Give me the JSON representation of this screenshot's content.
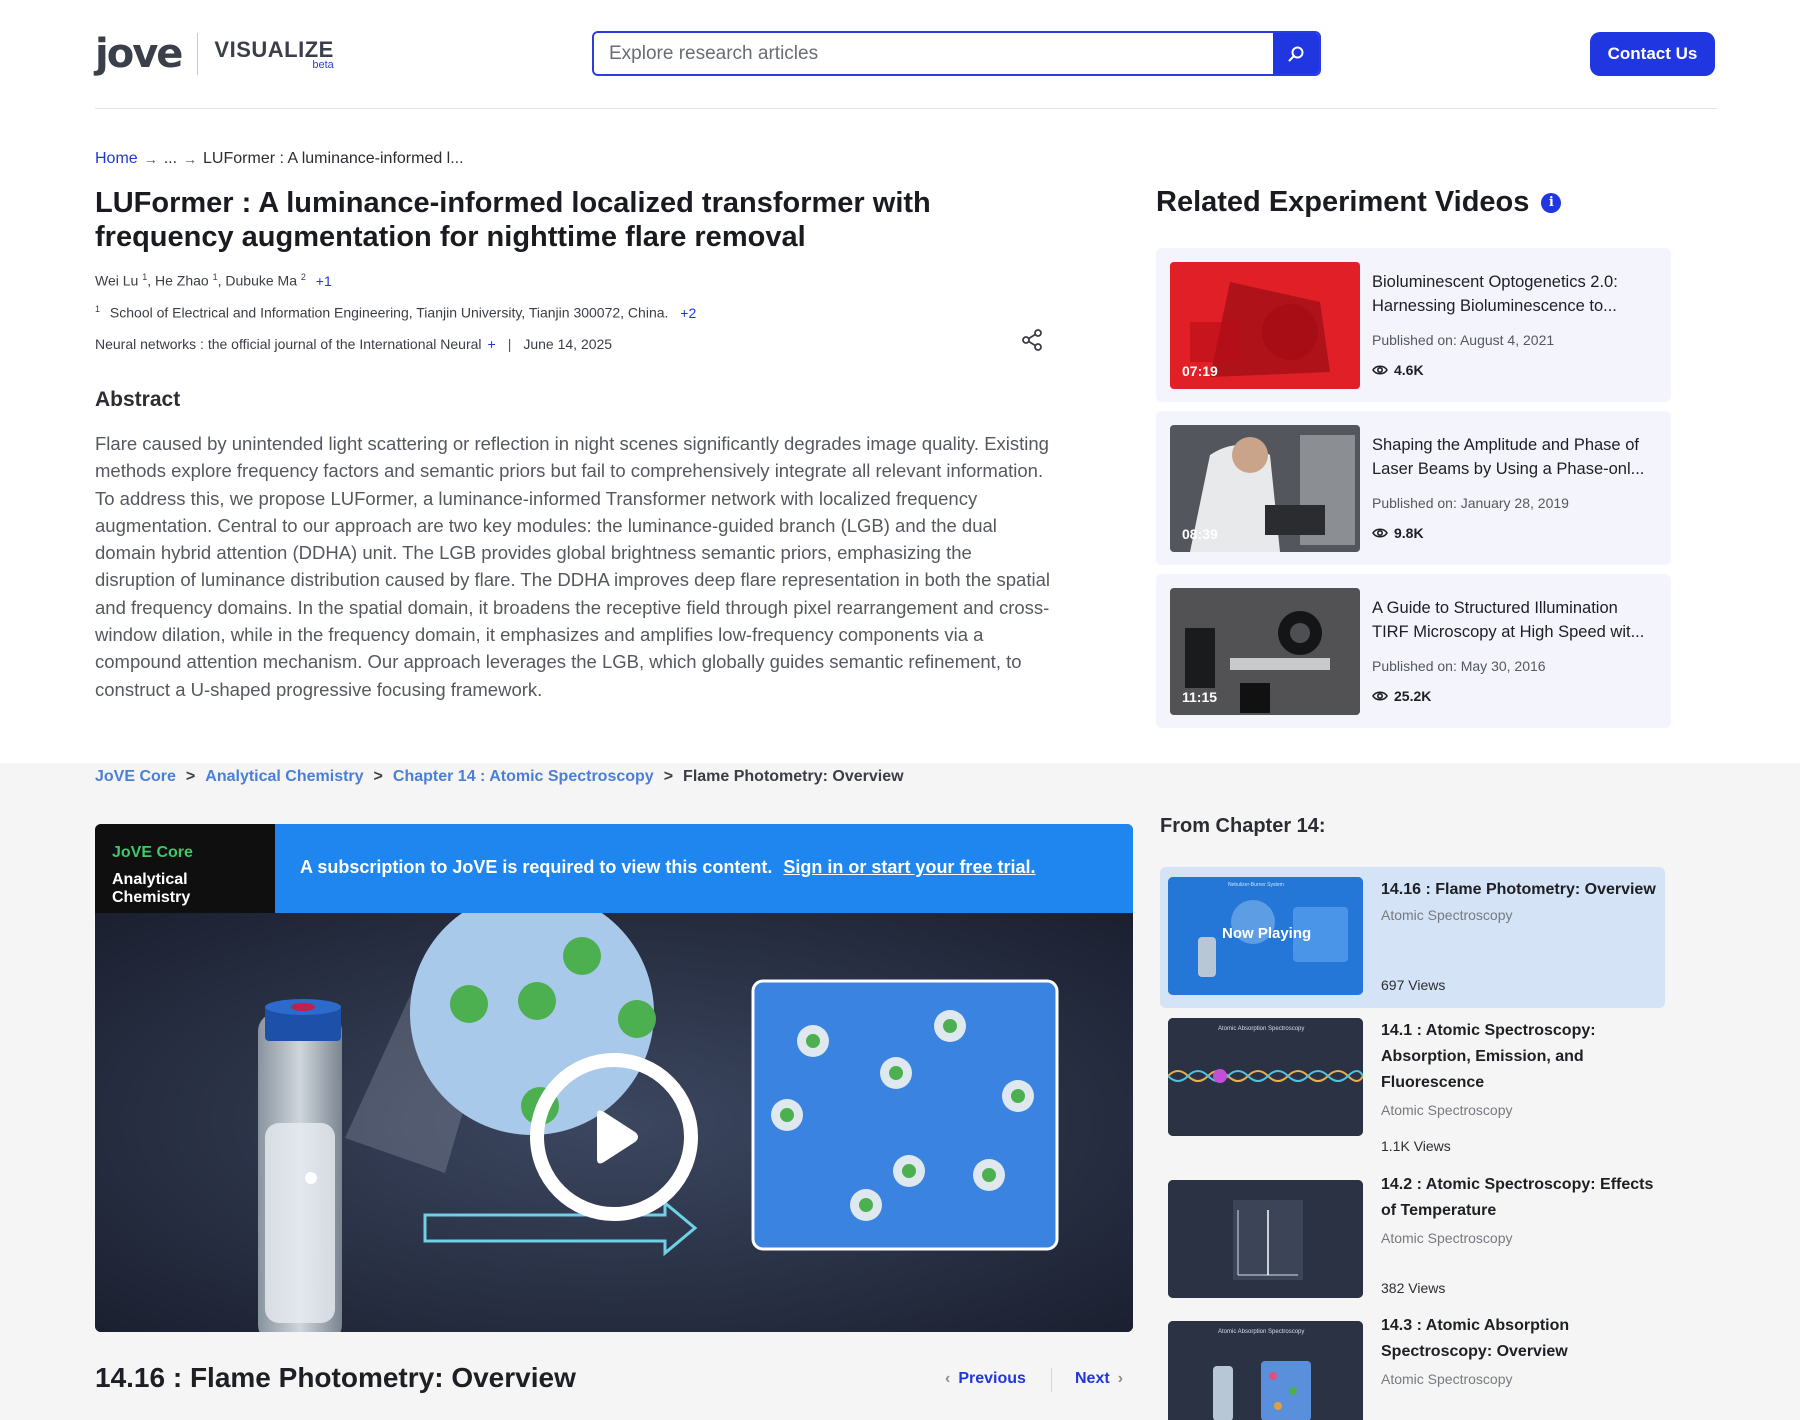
{
  "header": {
    "logo_text": "jove",
    "logo_product": "VISUALIZE",
    "logo_badge": "beta",
    "search_placeholder": "Explore research articles",
    "contact_label": "Contact Us"
  },
  "breadcrumb": {
    "home": "Home",
    "ellipsis": "...",
    "current": "LUFormer : A luminance-informed l..."
  },
  "article": {
    "title": "LUFormer : A luminance-informed localized transformer with frequency augmentation for nighttime flare removal",
    "authors": [
      {
        "name": "Wei Lu",
        "sup": "1"
      },
      {
        "name": "He Zhao",
        "sup": "1"
      },
      {
        "name": "Dubuke Ma",
        "sup": "2"
      }
    ],
    "authors_more": "+1",
    "affiliation_sup": "1",
    "affiliation": "School of Electrical and Information Engineering, Tianjin University, Tianjin 300072, China.",
    "affiliation_more": "+2",
    "journal": "Neural networks : the official journal of the International Neural",
    "journal_more": "+",
    "date": "June 14, 2025",
    "abstract_heading": "Abstract",
    "abstract": "Flare caused by unintended light scattering or reflection in night scenes significantly degrades image quality. Existing methods explore frequency factors and semantic priors but fail to comprehensively integrate all relevant information. To address this, we propose LUFormer, a luminance-informed Transformer network with localized frequency augmentation. Central to our approach are two key modules: the luminance-guided branch (LGB) and the dual domain hybrid attention (DDHA) unit. The LGB provides global brightness semantic priors, emphasizing the disruption of luminance distribution caused by flare. The DDHA improves deep flare representation in both the spatial and frequency domains. In the spatial domain, it broadens the receptive field through pixel rearrangement and cross-window dilation, while in the frequency domain, it emphasizes and amplifies low-frequency components via a compound attention mechanism. Our approach leverages the LGB, which globally guides semantic refinement, to construct a U-shaped progressive focusing framework."
  },
  "related": {
    "heading": "Related Experiment Videos",
    "info_icon": "i",
    "items": [
      {
        "title": "Bioluminescent Optogenetics 2.0: Harnessing Bioluminescence to...",
        "published": "Published on: August 4, 2021",
        "views": "4.6K",
        "duration": "07:19"
      },
      {
        "title": "Shaping the Amplitude and Phase of Laser Beams by Using a Phase-onl...",
        "published": "Published on: January 28, 2019",
        "views": "9.8K",
        "duration": "08:39"
      },
      {
        "title": "A Guide to Structured Illumination TIRF Microscopy at High Speed wit...",
        "published": "Published on: May 30, 2016",
        "views": "25.2K",
        "duration": "11:15"
      }
    ]
  },
  "course_breadcrumb": {
    "items": [
      "JoVE Core",
      "Analytical Chemistry",
      "Chapter 14 : Atomic Spectroscopy"
    ],
    "separator": ">",
    "current": "Flame Photometry: Overview"
  },
  "player": {
    "tag_line1": "JoVE Core",
    "tag_line2": "Analytical Chemistry",
    "message": "A subscription to JoVE is required to view this content.",
    "link": "Sign in or start your free trial."
  },
  "lesson": {
    "title": "14.16 : Flame Photometry: Overview",
    "prev_label": "Previous",
    "next_label": "Next"
  },
  "chapter": {
    "heading": "From Chapter 14:",
    "items": [
      {
        "title": "14.16 : Flame Photometry: Overview",
        "subtitle": "Atomic Spectroscopy",
        "views": "697 Views",
        "overlay": "Now Playing",
        "thumb_label": "Nebulizer-Burner System",
        "active": true
      },
      {
        "title": "14.1 : Atomic Spectroscopy: Absorption, Emission, and Fluorescence",
        "subtitle": "Atomic Spectroscopy",
        "views": "1.1K Views",
        "thumb_label": "Atomic Absorption Spectroscopy"
      },
      {
        "title": "14.2 : Atomic Spectroscopy: Effects of Temperature",
        "subtitle": "Atomic Spectroscopy",
        "views": "382 Views"
      },
      {
        "title": "14.3 : Atomic Absorption Spectroscopy: Overview",
        "subtitle": "Atomic Spectroscopy",
        "views": "",
        "thumb_label": "Atomic Absorption Spectroscopy"
      }
    ]
  }
}
